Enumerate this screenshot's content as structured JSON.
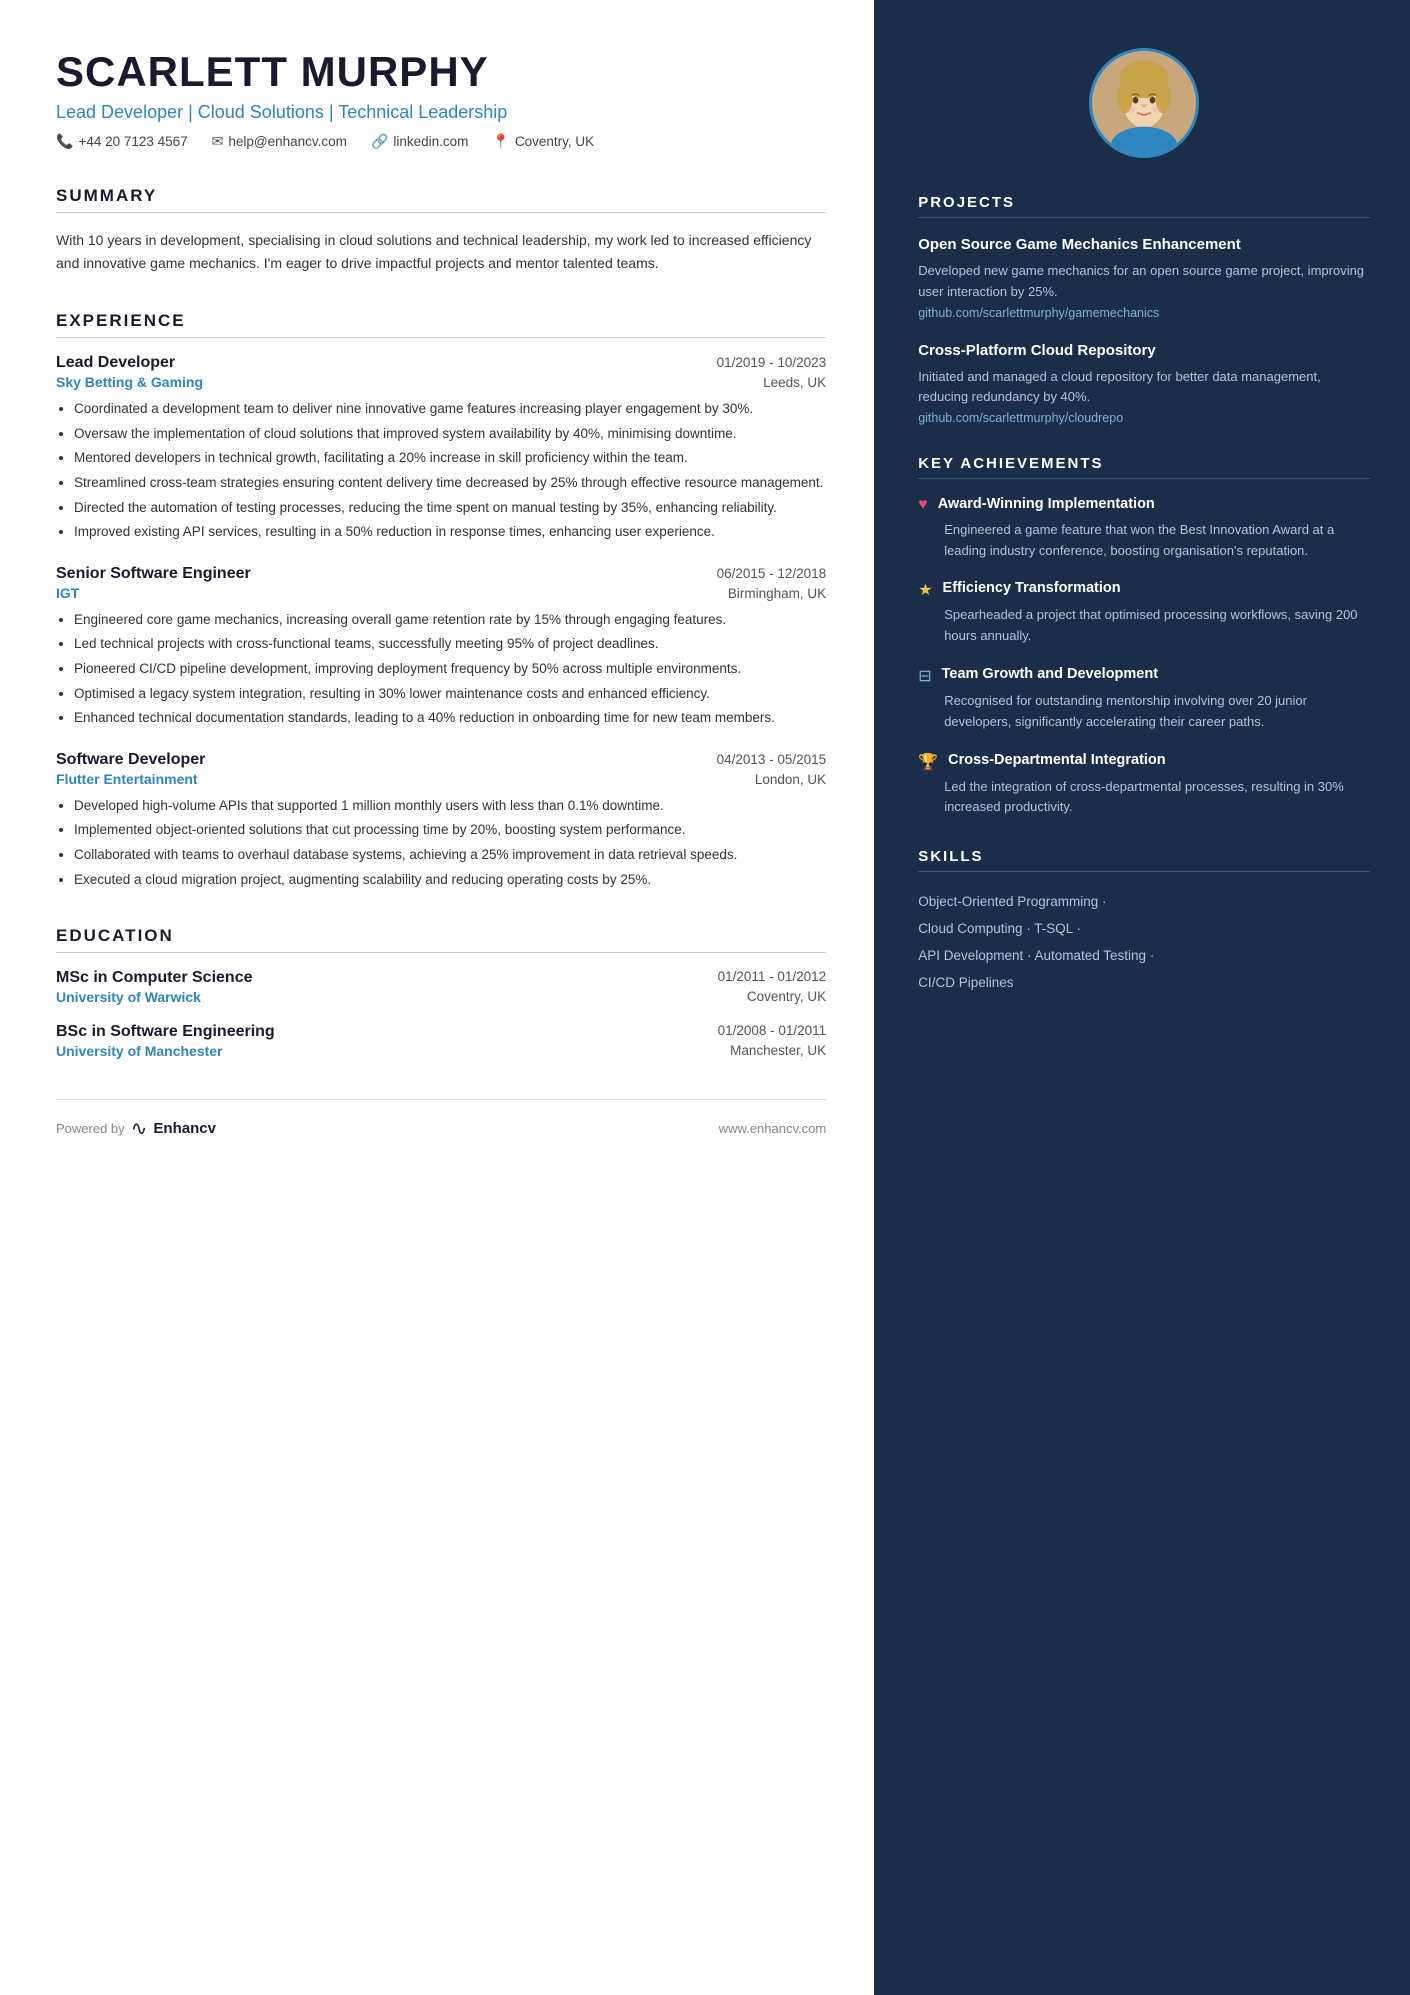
{
  "person": {
    "name": "SCARLETT MURPHY",
    "subtitle": "Lead Developer | Cloud Solutions | Technical Leadership",
    "phone": "+44 20 7123 4567",
    "email": "help@enhancv.com",
    "linkedin": "linkedin.com",
    "location": "Coventry, UK"
  },
  "summary": {
    "title": "SUMMARY",
    "text": "With 10 years in development, specialising in cloud solutions and technical leadership, my work led to increased efficiency and innovative game mechanics. I'm eager to drive impactful projects and mentor talented teams."
  },
  "experience": {
    "title": "EXPERIENCE",
    "jobs": [
      {
        "title": "Lead Developer",
        "dates": "01/2019 - 10/2023",
        "company": "Sky Betting & Gaming",
        "location": "Leeds, UK",
        "bullets": [
          "Coordinated a development team to deliver nine innovative game features increasing player engagement by 30%.",
          "Oversaw the implementation of cloud solutions that improved system availability by 40%, minimising downtime.",
          "Mentored developers in technical growth, facilitating a 20% increase in skill proficiency within the team.",
          "Streamlined cross-team strategies ensuring content delivery time decreased by 25% through effective resource management.",
          "Directed the automation of testing processes, reducing the time spent on manual testing by 35%, enhancing reliability.",
          "Improved existing API services, resulting in a 50% reduction in response times, enhancing user experience."
        ]
      },
      {
        "title": "Senior Software Engineer",
        "dates": "06/2015 - 12/2018",
        "company": "IGT",
        "location": "Birmingham, UK",
        "bullets": [
          "Engineered core game mechanics, increasing overall game retention rate by 15% through engaging features.",
          "Led technical projects with cross-functional teams, successfully meeting 95% of project deadlines.",
          "Pioneered CI/CD pipeline development, improving deployment frequency by 50% across multiple environments.",
          "Optimised a legacy system integration, resulting in 30% lower maintenance costs and enhanced efficiency.",
          "Enhanced technical documentation standards, leading to a 40% reduction in onboarding time for new team members."
        ]
      },
      {
        "title": "Software Developer",
        "dates": "04/2013 - 05/2015",
        "company": "Flutter Entertainment",
        "location": "London, UK",
        "bullets": [
          "Developed high-volume APIs that supported 1 million monthly users with less than 0.1% downtime.",
          "Implemented object-oriented solutions that cut processing time by 20%, boosting system performance.",
          "Collaborated with teams to overhaul database systems, achieving a 25% improvement in data retrieval speeds.",
          "Executed a cloud migration project, augmenting scalability and reducing operating costs by 25%."
        ]
      }
    ]
  },
  "education": {
    "title": "EDUCATION",
    "degrees": [
      {
        "degree": "MSc in Computer Science",
        "dates": "01/2011 - 01/2012",
        "school": "University of Warwick",
        "location": "Coventry, UK"
      },
      {
        "degree": "BSc in Software Engineering",
        "dates": "01/2008 - 01/2011",
        "school": "University of Manchester",
        "location": "Manchester, UK"
      }
    ]
  },
  "footer": {
    "powered_by": "Powered by",
    "brand": "Enhancv",
    "website": "www.enhancv.com"
  },
  "projects": {
    "title": "PROJECTS",
    "items": [
      {
        "name": "Open Source Game Mechanics Enhancement",
        "desc": "Developed new game mechanics for an open source game project, improving user interaction by 25%.",
        "link": "github.com/scarlettmurphy/gamemechanics"
      },
      {
        "name": "Cross-Platform Cloud Repository",
        "desc": "Initiated and managed a cloud repository for better data management, reducing redundancy by 40%.",
        "link": "github.com/scarlettmurphy/cloudrepo"
      }
    ]
  },
  "achievements": {
    "title": "KEY ACHIEVEMENTS",
    "items": [
      {
        "icon": "♥",
        "icon_color": "#e74c6d",
        "title": "Award-Winning Implementation",
        "desc": "Engineered a game feature that won the Best Innovation Award at a leading industry conference, boosting organisation's reputation."
      },
      {
        "icon": "★",
        "icon_color": "#f0c040",
        "title": "Efficiency Transformation",
        "desc": "Spearheaded a project that optimised processing workflows, saving 200 hours annually."
      },
      {
        "icon": "⊟",
        "icon_color": "#7fb3d3",
        "title": "Team Growth and Development",
        "desc": "Recognised for outstanding mentorship involving over 20 junior developers, significantly accelerating their career paths."
      },
      {
        "icon": "🏆",
        "icon_color": "#f0c040",
        "title": "Cross-Departmental Integration",
        "desc": "Led the integration of cross-departmental processes, resulting in 30% increased productivity."
      }
    ]
  },
  "skills": {
    "title": "SKILLS",
    "items": [
      "Object-Oriented Programming ·",
      "Cloud Computing · T-SQL ·",
      "API Development · Automated Testing ·",
      "CI/CD Pipelines"
    ]
  }
}
